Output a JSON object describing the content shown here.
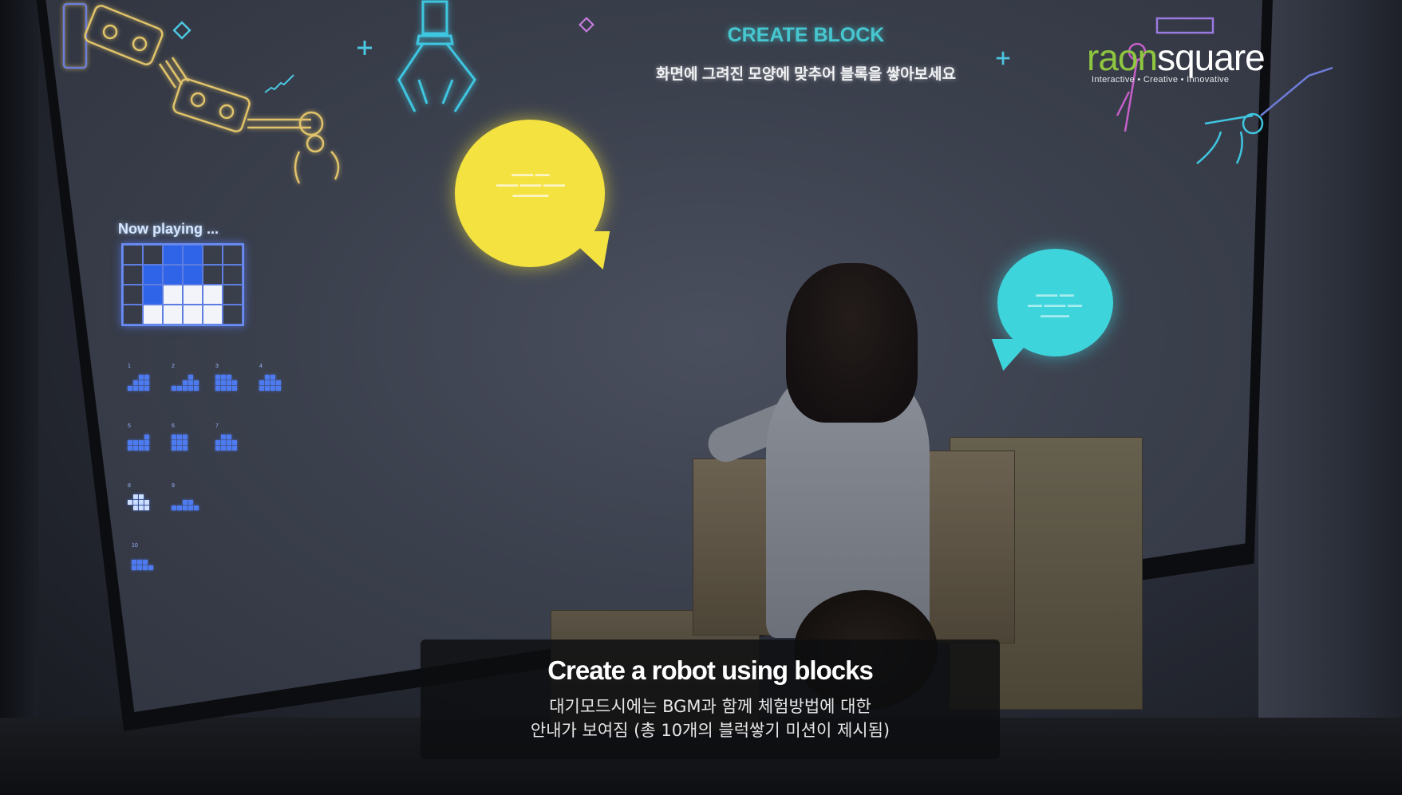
{
  "projection": {
    "mission_title": "CREATE BLOCK",
    "mission_instruction": "화면에 그려진 모양에 맞추어 블록을 쌓아보세요",
    "now_playing_label": "Now playing ...",
    "now_playing_grid": [
      [
        "empty",
        "empty",
        "blue",
        "blue",
        "empty",
        "empty"
      ],
      [
        "empty",
        "blue",
        "blue",
        "blue",
        "empty",
        "empty"
      ],
      [
        "empty",
        "blue",
        "white",
        "white",
        "white",
        "empty"
      ],
      [
        "empty",
        "white",
        "white",
        "white",
        "white",
        "empty"
      ]
    ],
    "mission_thumbnails": [
      {
        "number": "1",
        "done": false
      },
      {
        "number": "2",
        "done": false
      },
      {
        "number": "3",
        "done": false
      },
      {
        "number": "4",
        "done": false
      },
      {
        "number": "5",
        "done": false
      },
      {
        "number": "6",
        "done": false
      },
      {
        "number": "7",
        "done": false
      },
      {
        "number": "8",
        "done": true
      },
      {
        "number": "9",
        "done": false
      },
      {
        "number": "10",
        "done": false
      }
    ],
    "bubble_yellow_color": "#f4e240",
    "bubble_cyan_color": "#3ed4dc"
  },
  "brand": {
    "logo_part1": "raon",
    "logo_part2": "square",
    "tagline": "Interactive • Creative • Innovative",
    "accent_color": "#8ec63f"
  },
  "caption": {
    "title": "Create a robot using blocks",
    "line1": "대기모드시에는 BGM과 함께 체험방법에 대한",
    "line2": "안내가 보여짐 (총 10개의 블럭쌓기 미션이 제시됨)"
  }
}
